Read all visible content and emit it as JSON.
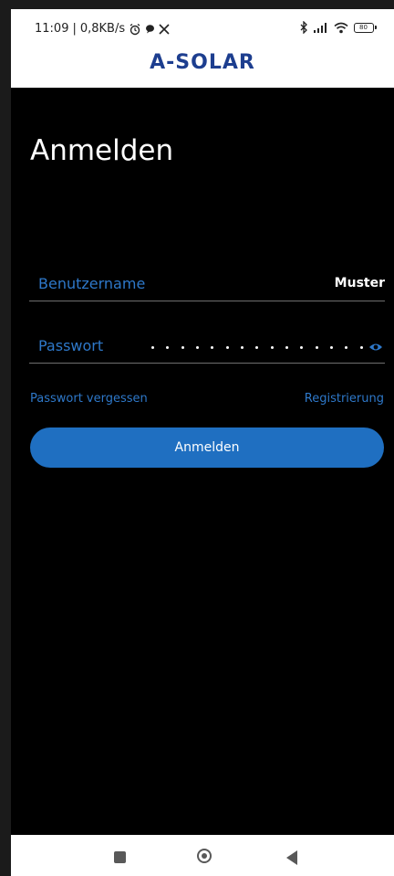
{
  "status_bar": {
    "time": "11:09",
    "speed": "0,8KB/s",
    "icons": [
      "alarm-icon",
      "chat-icon",
      "x-icon"
    ],
    "right_icons": [
      "bluetooth-icon",
      "signal-icon",
      "wifi-icon",
      "battery-icon"
    ],
    "battery": "80"
  },
  "header": {
    "brand": "A-SOLAR",
    "brand_color": "#1d3e8f"
  },
  "page": {
    "title": "Anmelden"
  },
  "form": {
    "username_label": "Benutzername",
    "username_value": "Muster",
    "password_label": "Passwort",
    "password_masked_length": 15,
    "password_visibility_icon": "eye-icon"
  },
  "links": {
    "forgot_password": "Passwort vergessen",
    "register": "Registrierung"
  },
  "actions": {
    "login_label": "Anmelden"
  },
  "colors": {
    "accent": "#2e78c9",
    "button": "#1f6fc1",
    "background": "#000000"
  },
  "nav": {
    "icons": [
      "recent-apps-icon",
      "home-icon",
      "back-icon"
    ]
  }
}
